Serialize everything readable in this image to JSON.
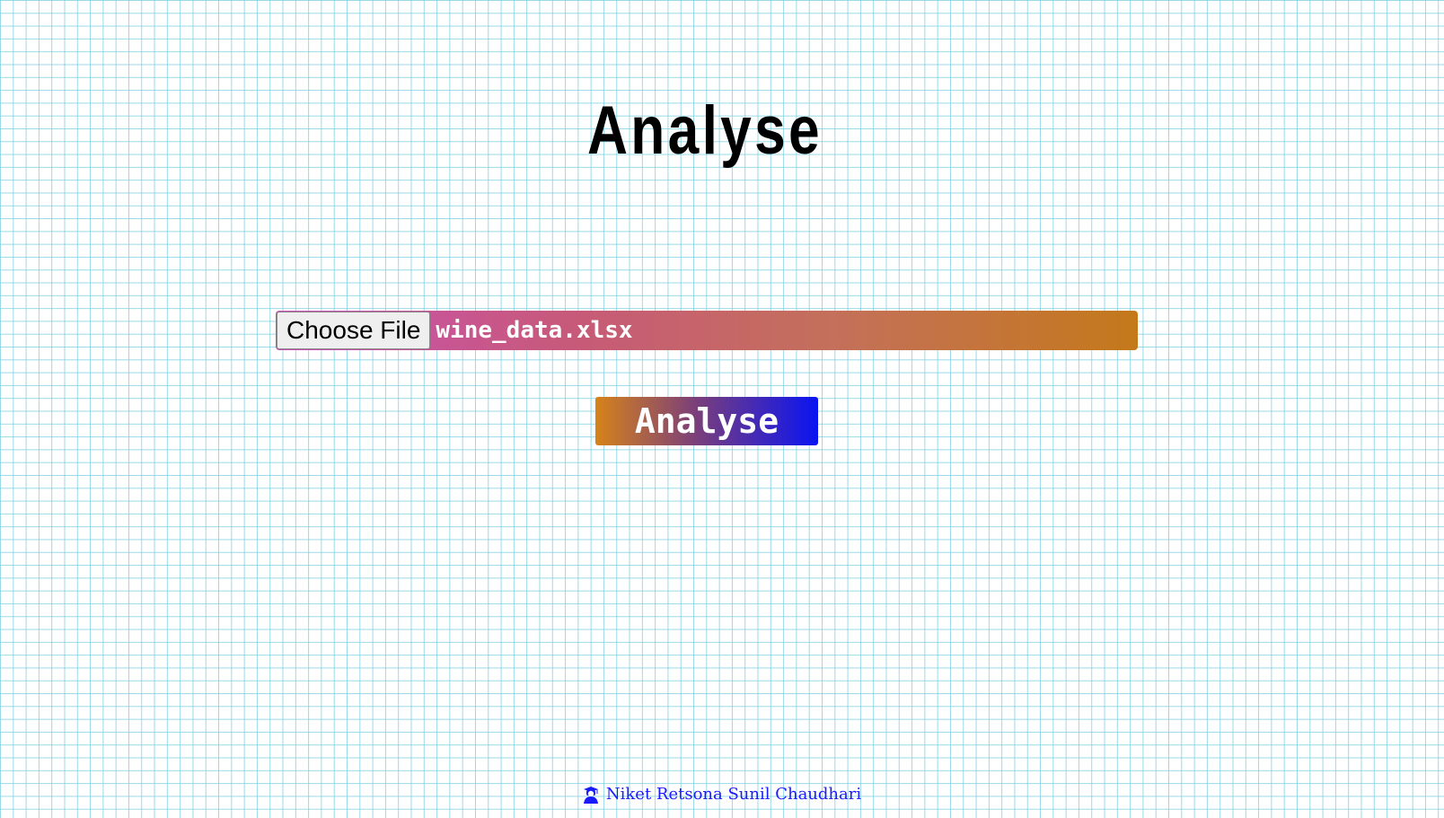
{
  "header": {
    "title": "Analyse"
  },
  "upload": {
    "button_label": "Choose File",
    "file_name": "wine_data.xlsx"
  },
  "actions": {
    "analyse_label": "Analyse"
  },
  "footer": {
    "icon": "graduate-icon",
    "author": "Niket Retsona Sunil Chaudhari"
  },
  "colors": {
    "grid_line": "#78cde1",
    "file_bar_start": "#c94fb6",
    "file_bar_end": "#c4791a",
    "button_start": "#d6831a",
    "button_end": "#0a14f2",
    "footer_text": "#1a1aff"
  }
}
